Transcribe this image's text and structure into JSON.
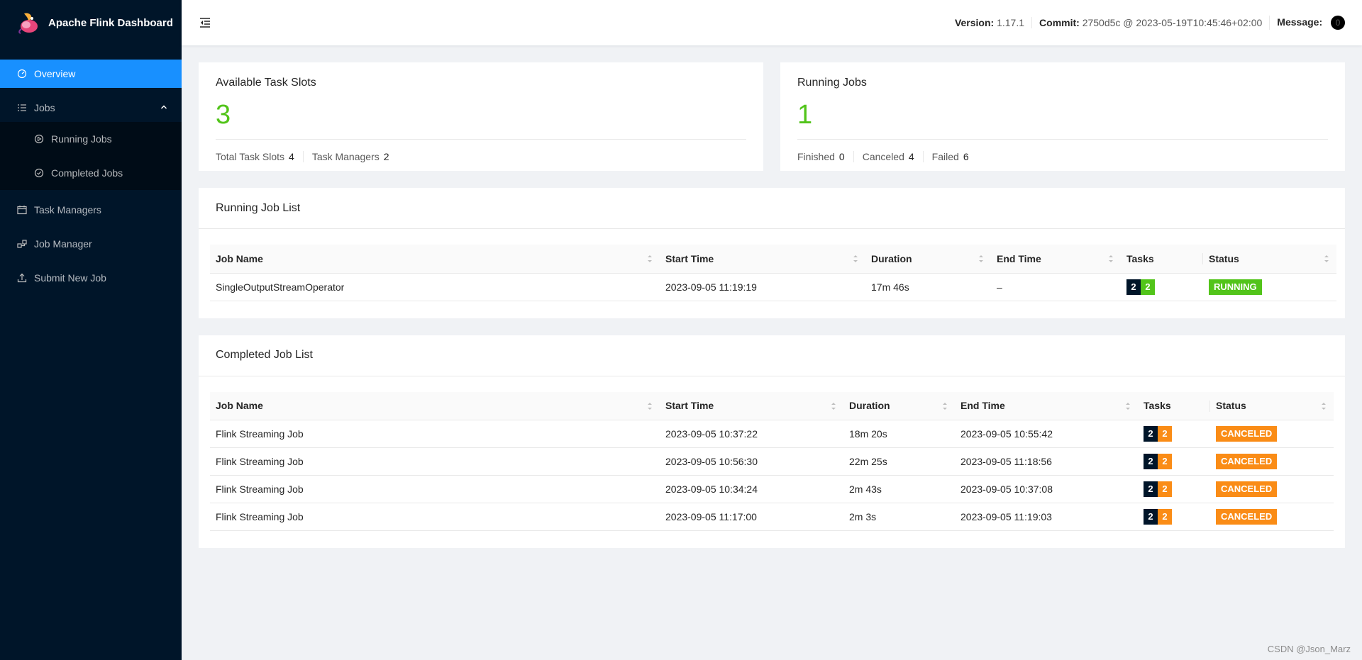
{
  "app": {
    "title": "Apache Flink Dashboard"
  },
  "sidebar": {
    "items": [
      {
        "label": "Overview",
        "icon": "dashboard-icon"
      },
      {
        "label": "Jobs",
        "icon": "list-icon"
      },
      {
        "label": "Running Jobs",
        "icon": "play-circle-icon"
      },
      {
        "label": "Completed Jobs",
        "icon": "check-circle-icon"
      },
      {
        "label": "Task Managers",
        "icon": "schedule-icon"
      },
      {
        "label": "Job Manager",
        "icon": "cluster-icon"
      },
      {
        "label": "Submit New Job",
        "icon": "upload-icon"
      }
    ]
  },
  "header": {
    "version_label": "Version:",
    "version": "1.17.1",
    "commit_label": "Commit:",
    "commit": "2750d5c @ 2023-05-19T10:45:46+02:00",
    "message_label": "Message:",
    "message_count": "0"
  },
  "stats": {
    "slots": {
      "title": "Available Task Slots",
      "value": "3",
      "total_label": "Total Task Slots",
      "total": "4",
      "tm_label": "Task Managers",
      "tm": "2"
    },
    "jobs": {
      "title": "Running Jobs",
      "value": "1",
      "finished_label": "Finished",
      "finished": "0",
      "canceled_label": "Canceled",
      "canceled": "4",
      "failed_label": "Failed",
      "failed": "6"
    }
  },
  "running": {
    "title": "Running Job List",
    "columns": [
      "Job Name",
      "Start Time",
      "Duration",
      "End Time",
      "Tasks",
      "Status"
    ],
    "rows": [
      {
        "name": "SingleOutputStreamOperator",
        "start": "2023-09-05 11:19:19",
        "duration": "17m 46s",
        "end": "–",
        "tasks_a": "2",
        "tasks_b": "2",
        "status": "RUNNING"
      }
    ]
  },
  "completed": {
    "title": "Completed Job List",
    "columns": [
      "Job Name",
      "Start Time",
      "Duration",
      "End Time",
      "Tasks",
      "Status"
    ],
    "rows": [
      {
        "name": "Flink Streaming Job",
        "start": "2023-09-05 10:37:22",
        "duration": "18m 20s",
        "end": "2023-09-05 10:55:42",
        "tasks_a": "2",
        "tasks_b": "2",
        "status": "CANCELED"
      },
      {
        "name": "Flink Streaming Job",
        "start": "2023-09-05 10:56:30",
        "duration": "22m 25s",
        "end": "2023-09-05 11:18:56",
        "tasks_a": "2",
        "tasks_b": "2",
        "status": "CANCELED"
      },
      {
        "name": "Flink Streaming Job",
        "start": "2023-09-05 10:34:24",
        "duration": "2m 43s",
        "end": "2023-09-05 10:37:08",
        "tasks_a": "2",
        "tasks_b": "2",
        "status": "CANCELED"
      },
      {
        "name": "Flink Streaming Job",
        "start": "2023-09-05 11:17:00",
        "duration": "2m 3s",
        "end": "2023-09-05 11:19:03",
        "tasks_a": "2",
        "tasks_b": "2",
        "status": "CANCELED"
      }
    ]
  },
  "watermark": "CSDN @Json_Marz",
  "colors": {
    "sidebar": "#001529",
    "active": "#1890ff",
    "green": "#52c41a",
    "orange": "#fa8c16"
  }
}
